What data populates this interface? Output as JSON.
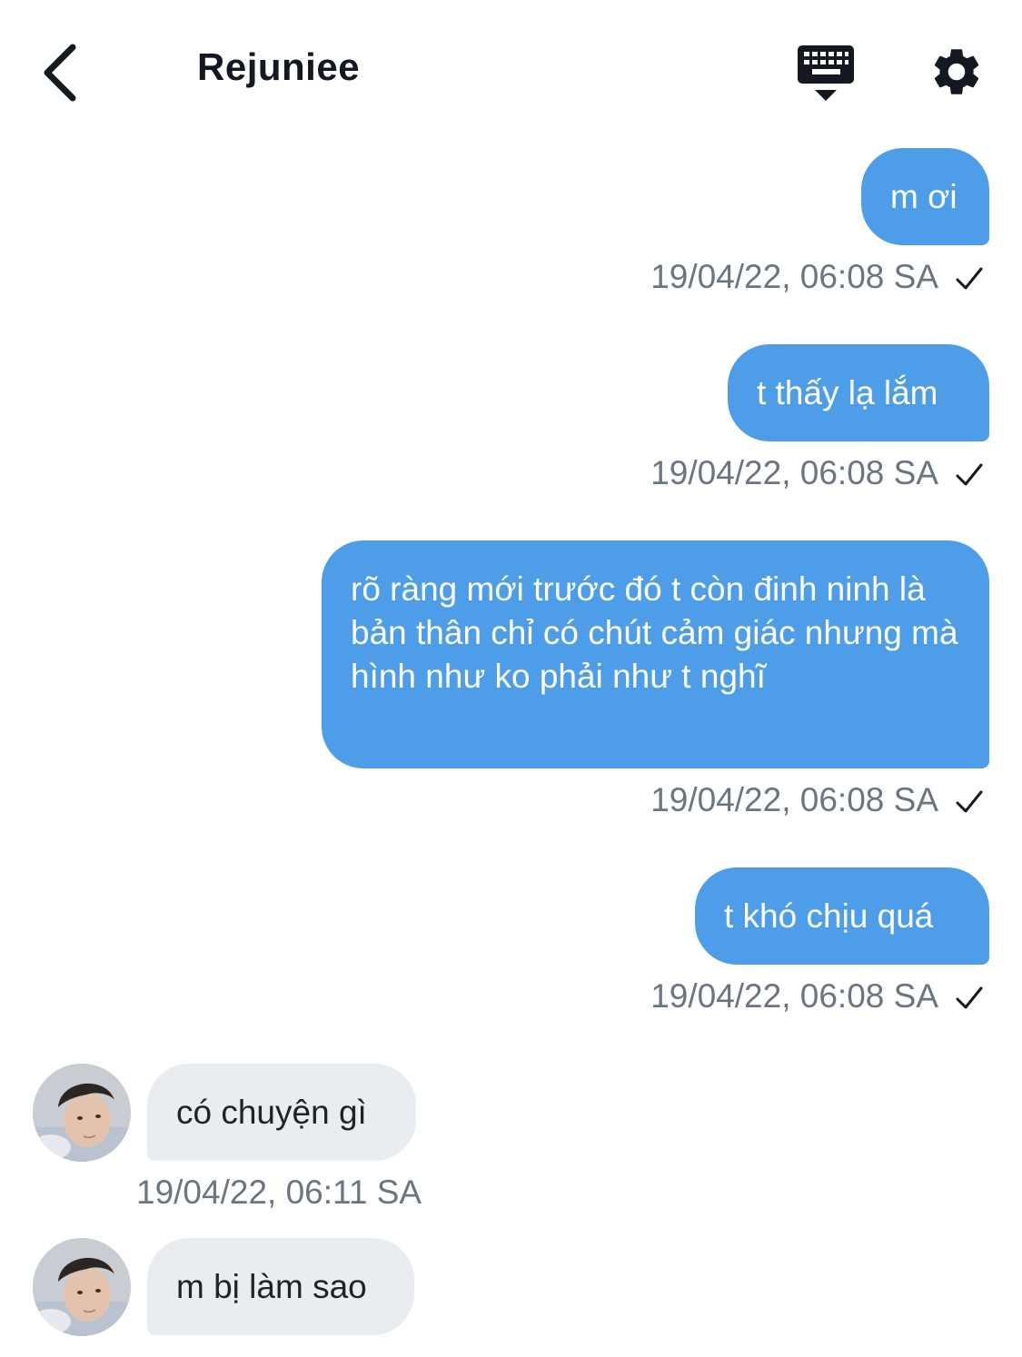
{
  "header": {
    "title": "Rejuniee"
  },
  "icons": {
    "back": "chevron-left-icon",
    "keyboard": "keyboard-icon",
    "settings": "gear-icon",
    "delivered": "checkmark-icon"
  },
  "colors": {
    "outgoing_bubble": "#4d9de8",
    "incoming_bubble": "#e9ecf0",
    "timestamp": "#6b7582",
    "title": "#141823"
  },
  "messages": [
    {
      "direction": "out",
      "text": "m ơi",
      "time": "19/04/22, 06:08 SA",
      "delivered": true
    },
    {
      "direction": "out",
      "text": "t thấy lạ lắm",
      "time": "19/04/22, 06:08 SA",
      "delivered": true
    },
    {
      "direction": "out",
      "text": "rõ ràng mới trước đó t còn đinh ninh là bản thân chỉ có chút cảm giác nhưng mà hình như ko phải như t nghĩ",
      "time": "19/04/22, 06:08 SA",
      "delivered": true
    },
    {
      "direction": "out",
      "text": "t khó chịu quá",
      "time": "19/04/22, 06:08 SA",
      "delivered": true
    },
    {
      "direction": "in",
      "text": "có chuyện gì",
      "time": "19/04/22, 06:11 SA"
    },
    {
      "direction": "in",
      "text": "m bị làm sao"
    }
  ]
}
